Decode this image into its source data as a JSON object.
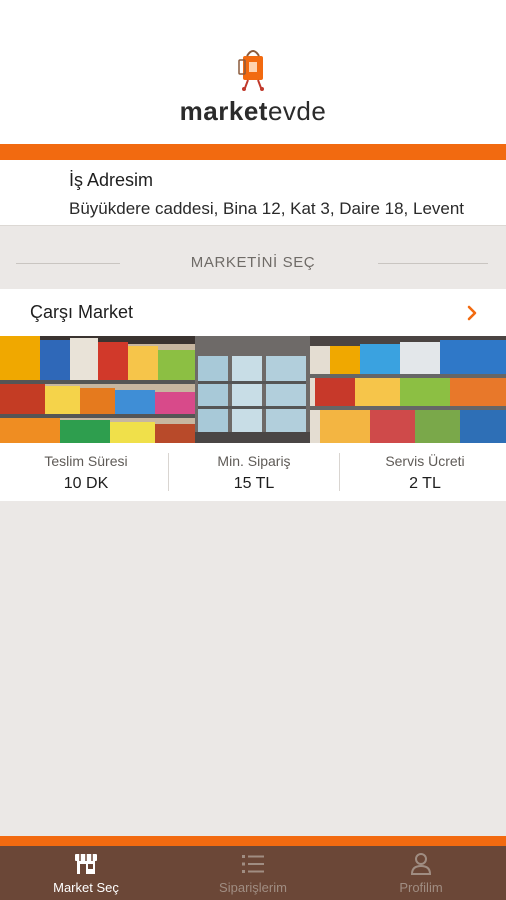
{
  "app": {
    "logo_bold": "market",
    "logo_light": "evde",
    "brand_color": "#f26a10"
  },
  "address": {
    "icon": "location-target-icon",
    "title": "İş Adresim",
    "line": "Büyükdere caddesi, Bina 12, Kat 3, Daire 18, Levent"
  },
  "section": {
    "title": "MARKETİNİ SEÇ"
  },
  "market": {
    "name": "Çarşı Market",
    "arrow_icon": "chevron-right-icon",
    "image": "supermarket-shelves-photo",
    "stats": [
      {
        "label": "Teslim Süresi",
        "value": "10 DK"
      },
      {
        "label": "Min. Sipariş",
        "value": "15 TL"
      },
      {
        "label": "Servis Ücreti",
        "value": "2 TL"
      }
    ]
  },
  "tabs": [
    {
      "label": "Market Seç",
      "icon": "store-icon",
      "active": true
    },
    {
      "label": "Siparişlerim",
      "icon": "list-icon",
      "active": false
    },
    {
      "label": "Profilim",
      "icon": "user-icon",
      "active": false
    }
  ]
}
